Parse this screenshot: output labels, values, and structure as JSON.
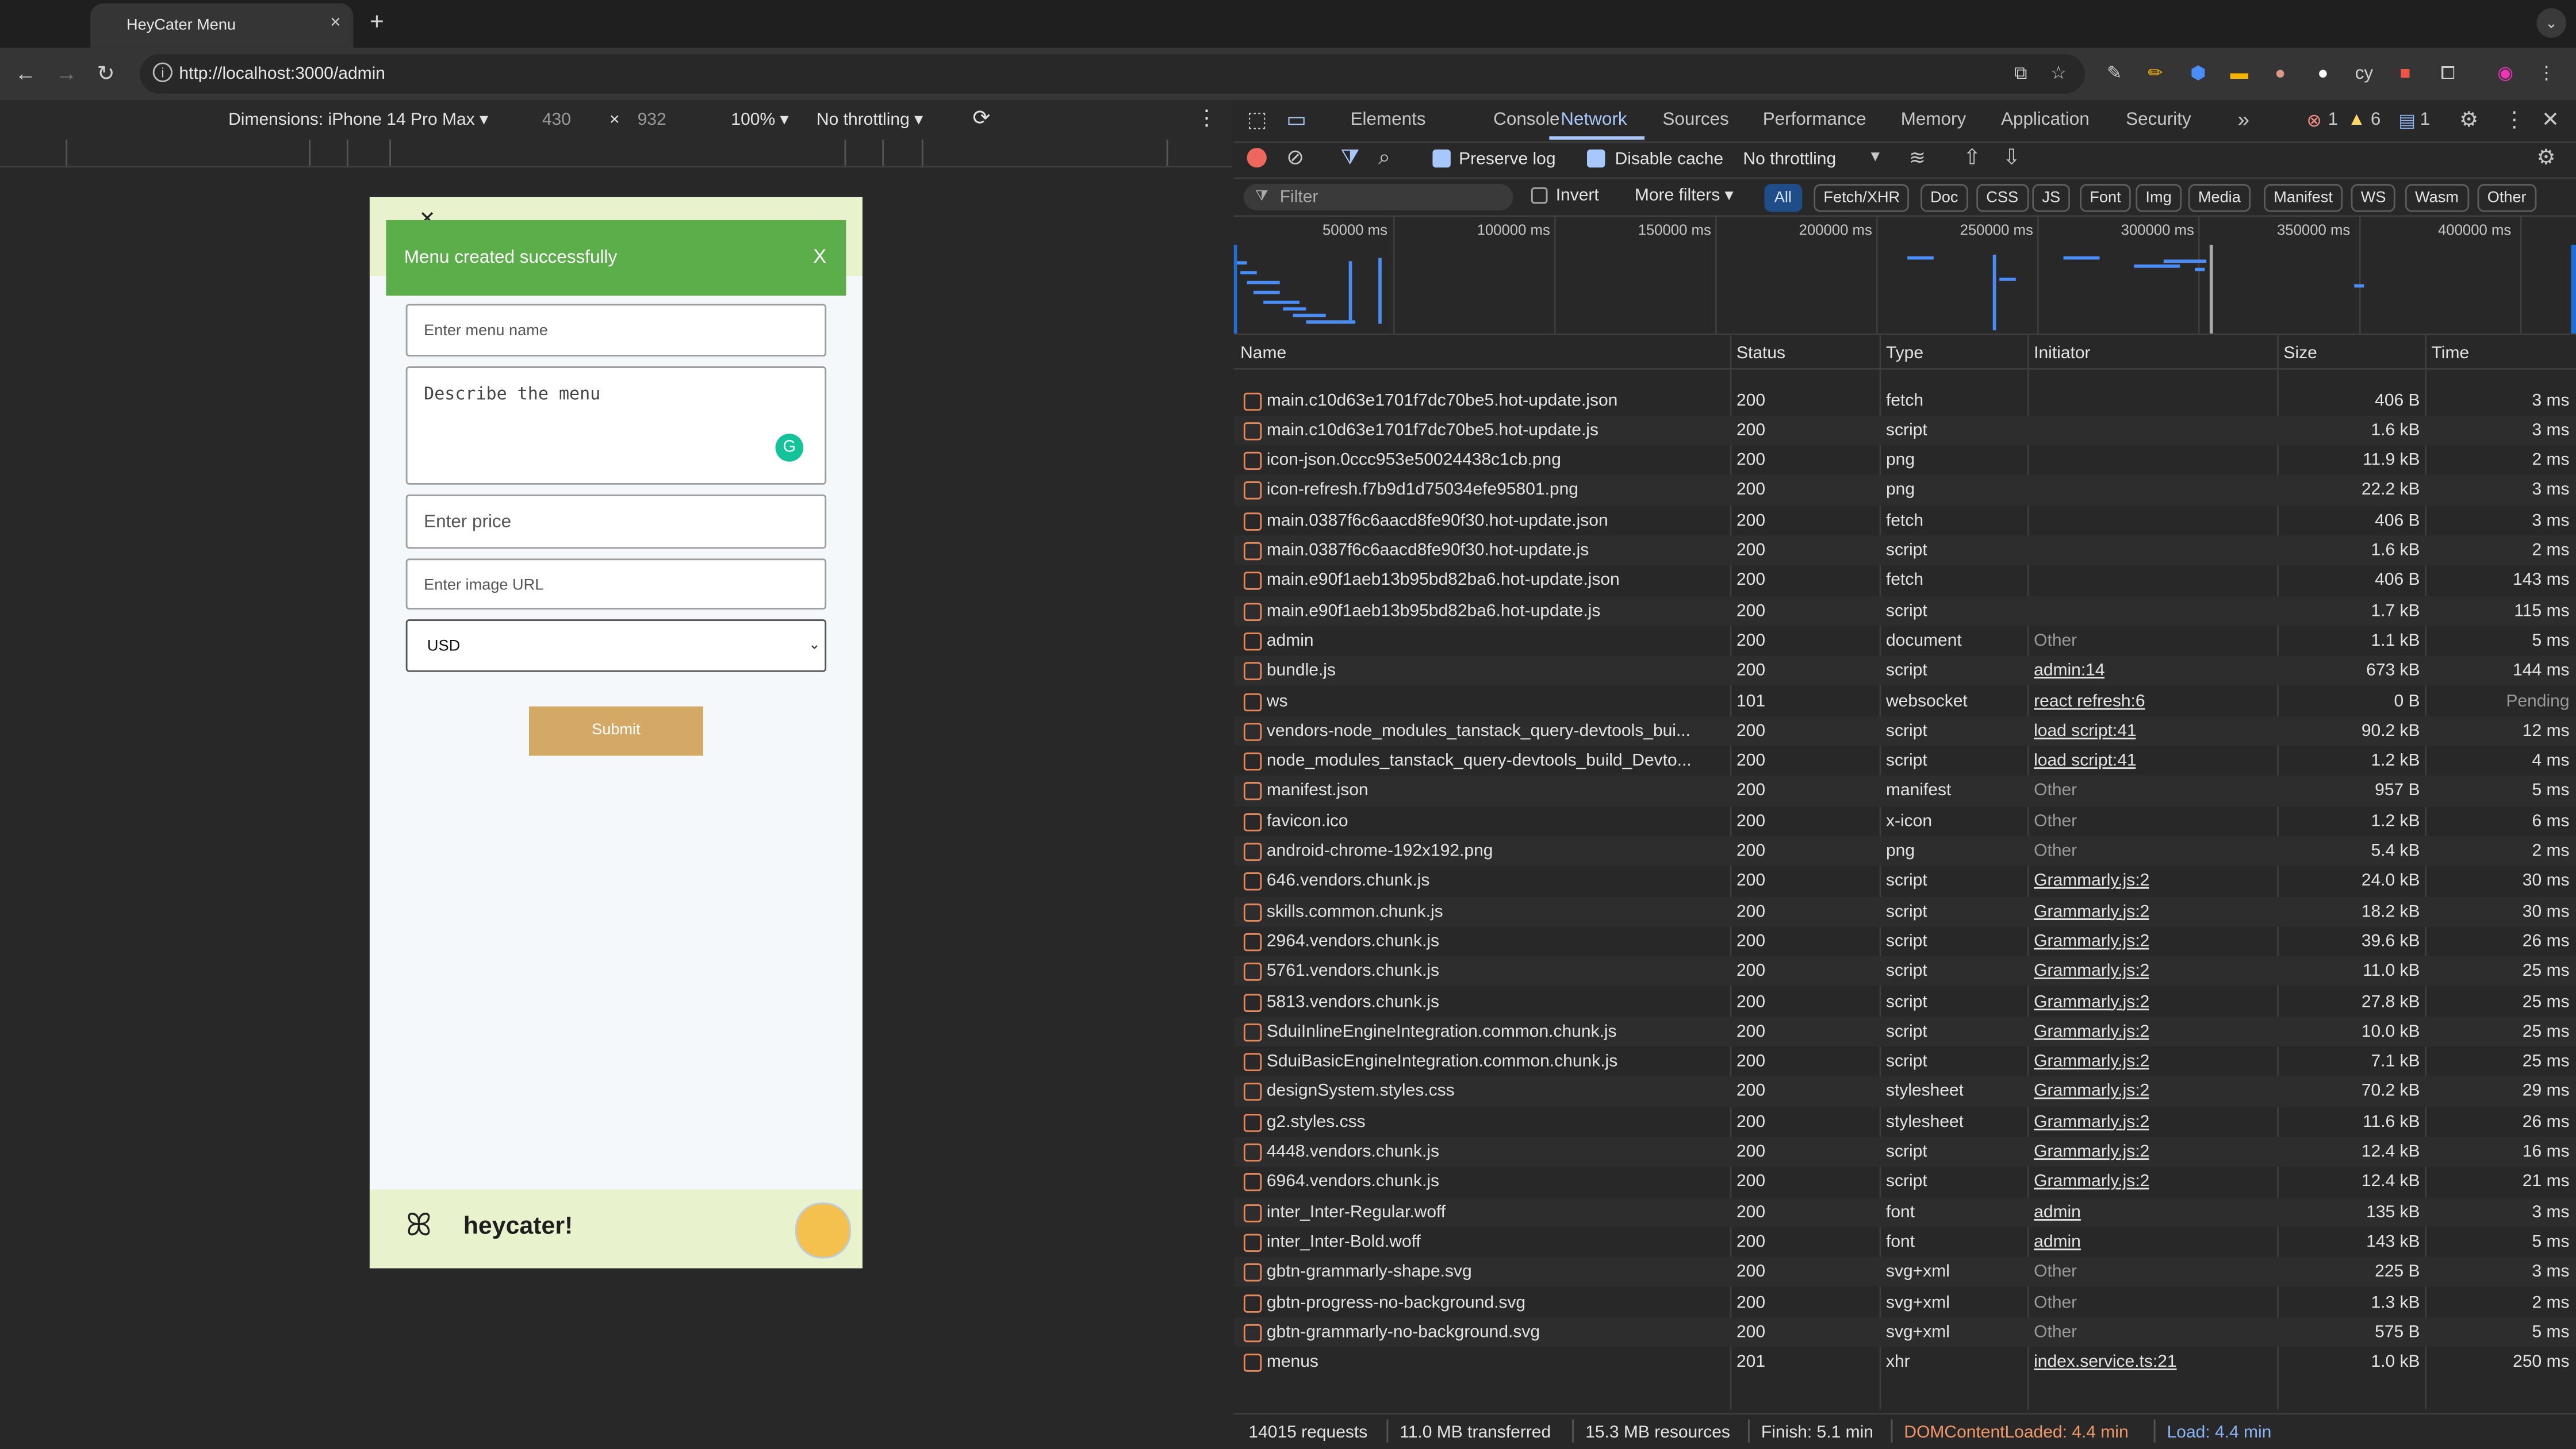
{
  "browser": {
    "tab_title": "HeyCater Menu",
    "tab_close": "×",
    "new_tab": "+",
    "url": "http://localhost:3000/admin",
    "tab_menu": "⌄"
  },
  "device_bar": {
    "dimensions_label": "Dimensions: iPhone 14 Pro Max ▾",
    "width": "430",
    "times": "×",
    "height": "932",
    "zoom": "100% ▾",
    "throttle": "No throttling ▾"
  },
  "app": {
    "toast_message": "Menu created successfully",
    "toast_close": "X",
    "menu_name_placeholder": "Enter menu name",
    "description_placeholder": "Describe the menu",
    "price_placeholder": "Enter price",
    "image_placeholder": "Enter image URL",
    "currency": "USD",
    "submit_label": "Submit",
    "brand": "heycater!"
  },
  "devtools": {
    "tabs": [
      "Elements",
      "Console",
      "Network",
      "Sources",
      "Performance",
      "Memory",
      "Application",
      "Security",
      "»"
    ],
    "active_tab": "Network",
    "errors": "1",
    "warnings": "6",
    "messages": "1",
    "preserve_log": "Preserve log",
    "disable_cache": "Disable cache",
    "throttling": "No throttling",
    "filter_placeholder": "Filter",
    "invert": "Invert",
    "more_filters": "More filters ▾",
    "filter_chips": [
      "All",
      "Fetch/XHR",
      "Doc",
      "CSS",
      "JS",
      "Font",
      "Img",
      "Media",
      "Manifest",
      "WS",
      "Wasm",
      "Other"
    ],
    "timeline_ticks": [
      "50000 ms",
      "100000 ms",
      "150000 ms",
      "200000 ms",
      "250000 ms",
      "300000 ms",
      "350000 ms",
      "400000 ms"
    ],
    "columns": [
      "Name",
      "Status",
      "Type",
      "Initiator",
      "Size",
      "Time"
    ],
    "rows": [
      {
        "name": "main.c10d63e1701f7dc70be5.hot-update.json",
        "status": "200",
        "type": "fetch",
        "initiator": "",
        "size": "406 B",
        "time": "3 ms"
      },
      {
        "name": "main.c10d63e1701f7dc70be5.hot-update.js",
        "status": "200",
        "type": "script",
        "initiator": "",
        "size": "1.6 kB",
        "time": "3 ms"
      },
      {
        "name": "icon-json.0ccc953e50024438c1cb.png",
        "status": "200",
        "type": "png",
        "initiator": "",
        "size": "11.9 kB",
        "time": "2 ms"
      },
      {
        "name": "icon-refresh.f7b9d1d75034efe95801.png",
        "status": "200",
        "type": "png",
        "initiator": "",
        "size": "22.2 kB",
        "time": "3 ms"
      },
      {
        "name": "main.0387f6c6aacd8fe90f30.hot-update.json",
        "status": "200",
        "type": "fetch",
        "initiator": "",
        "size": "406 B",
        "time": "3 ms"
      },
      {
        "name": "main.0387f6c6aacd8fe90f30.hot-update.js",
        "status": "200",
        "type": "script",
        "initiator": "",
        "size": "1.6 kB",
        "time": "2 ms"
      },
      {
        "name": "main.e90f1aeb13b95bd82ba6.hot-update.json",
        "status": "200",
        "type": "fetch",
        "initiator": "",
        "size": "406 B",
        "time": "143 ms"
      },
      {
        "name": "main.e90f1aeb13b95bd82ba6.hot-update.js",
        "status": "200",
        "type": "script",
        "initiator": "",
        "size": "1.7 kB",
        "time": "115 ms"
      },
      {
        "name": "admin",
        "status": "200",
        "type": "document",
        "initiator": "Other",
        "size": "1.1 kB",
        "time": "5 ms"
      },
      {
        "name": "bundle.js",
        "status": "200",
        "type": "script",
        "initiator": "admin:14",
        "size": "673 kB",
        "time": "144 ms"
      },
      {
        "name": "ws",
        "status": "101",
        "type": "websocket",
        "initiator": "react refresh:6",
        "size": "0 B",
        "time": "Pending"
      },
      {
        "name": "vendors-node_modules_tanstack_query-devtools_bui...",
        "status": "200",
        "type": "script",
        "initiator": "load script:41",
        "size": "90.2 kB",
        "time": "12 ms"
      },
      {
        "name": "node_modules_tanstack_query-devtools_build_Devto...",
        "status": "200",
        "type": "script",
        "initiator": "load script:41",
        "size": "1.2 kB",
        "time": "4 ms"
      },
      {
        "name": "manifest.json",
        "status": "200",
        "type": "manifest",
        "initiator": "Other",
        "size": "957 B",
        "time": "5 ms"
      },
      {
        "name": "favicon.ico",
        "status": "200",
        "type": "x-icon",
        "initiator": "Other",
        "size": "1.2 kB",
        "time": "6 ms"
      },
      {
        "name": "android-chrome-192x192.png",
        "status": "200",
        "type": "png",
        "initiator": "Other",
        "size": "5.4 kB",
        "time": "2 ms"
      },
      {
        "name": "646.vendors.chunk.js",
        "status": "200",
        "type": "script",
        "initiator": "Grammarly.js:2",
        "size": "24.0 kB",
        "time": "30 ms"
      },
      {
        "name": "skills.common.chunk.js",
        "status": "200",
        "type": "script",
        "initiator": "Grammarly.js:2",
        "size": "18.2 kB",
        "time": "30 ms"
      },
      {
        "name": "2964.vendors.chunk.js",
        "status": "200",
        "type": "script",
        "initiator": "Grammarly.js:2",
        "size": "39.6 kB",
        "time": "26 ms"
      },
      {
        "name": "5761.vendors.chunk.js",
        "status": "200",
        "type": "script",
        "initiator": "Grammarly.js:2",
        "size": "11.0 kB",
        "time": "25 ms"
      },
      {
        "name": "5813.vendors.chunk.js",
        "status": "200",
        "type": "script",
        "initiator": "Grammarly.js:2",
        "size": "27.8 kB",
        "time": "25 ms"
      },
      {
        "name": "SduiInlineEngineIntegration.common.chunk.js",
        "status": "200",
        "type": "script",
        "initiator": "Grammarly.js:2",
        "size": "10.0 kB",
        "time": "25 ms"
      },
      {
        "name": "SduiBasicEngineIntegration.common.chunk.js",
        "status": "200",
        "type": "script",
        "initiator": "Grammarly.js:2",
        "size": "7.1 kB",
        "time": "25 ms"
      },
      {
        "name": "designSystem.styles.css",
        "status": "200",
        "type": "stylesheet",
        "initiator": "Grammarly.js:2",
        "size": "70.2 kB",
        "time": "29 ms"
      },
      {
        "name": "g2.styles.css",
        "status": "200",
        "type": "stylesheet",
        "initiator": "Grammarly.js:2",
        "size": "11.6 kB",
        "time": "26 ms"
      },
      {
        "name": "4448.vendors.chunk.js",
        "status": "200",
        "type": "script",
        "initiator": "Grammarly.js:2",
        "size": "12.4 kB",
        "time": "16 ms"
      },
      {
        "name": "6964.vendors.chunk.js",
        "status": "200",
        "type": "script",
        "initiator": "Grammarly.js:2",
        "size": "12.4 kB",
        "time": "21 ms"
      },
      {
        "name": "inter_Inter-Regular.woff",
        "status": "200",
        "type": "font",
        "initiator": "admin",
        "size": "135 kB",
        "time": "3 ms"
      },
      {
        "name": "inter_Inter-Bold.woff",
        "status": "200",
        "type": "font",
        "initiator": "admin",
        "size": "143 kB",
        "time": "5 ms"
      },
      {
        "name": "gbtn-grammarly-shape.svg",
        "status": "200",
        "type": "svg+xml",
        "initiator": "Other",
        "size": "225 B",
        "time": "3 ms"
      },
      {
        "name": "gbtn-progress-no-background.svg",
        "status": "200",
        "type": "svg+xml",
        "initiator": "Other",
        "size": "1.3 kB",
        "time": "2 ms"
      },
      {
        "name": "gbtn-grammarly-no-background.svg",
        "status": "200",
        "type": "svg+xml",
        "initiator": "Other",
        "size": "575 B",
        "time": "5 ms"
      },
      {
        "name": "menus",
        "status": "201",
        "type": "xhr",
        "initiator": "index.service.ts:21",
        "size": "1.0 kB",
        "time": "250 ms"
      }
    ],
    "status_bar": {
      "requests": "14015 requests",
      "transferred": "11.0 MB transferred",
      "resources": "15.3 MB resources",
      "finish": "Finish: 5.1 min",
      "dom_loaded": "DOMContentLoaded: 4.4 min",
      "load": "Load: 4.4 min"
    }
  },
  "colors": {
    "toast": "#5cae4a",
    "submit": "#d4a865",
    "header_footer": "#e8f2cc",
    "devtools_accent": "#a8c7fa",
    "dom_loaded": "#f29766",
    "load": "#8ab4f8"
  }
}
